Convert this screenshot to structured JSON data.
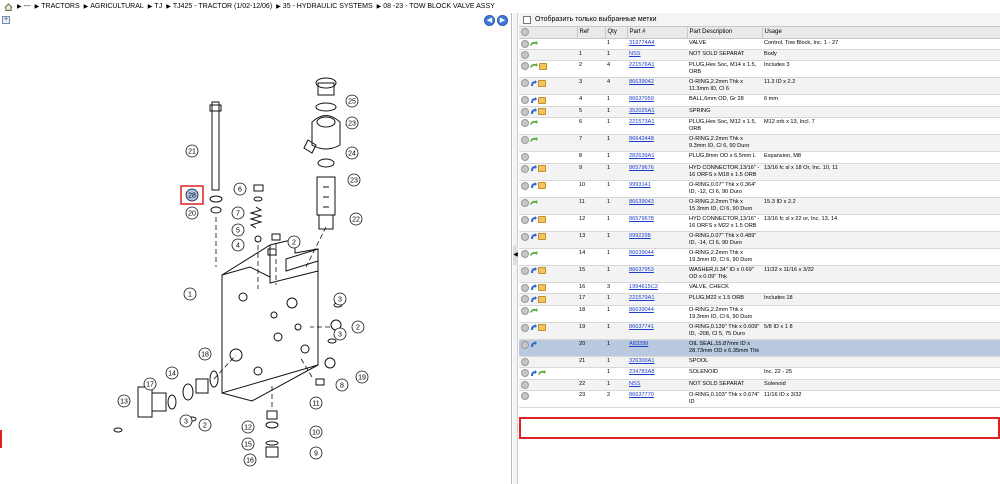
{
  "breadcrumb": {
    "items": [
      "---",
      "TRACTORS",
      "AGRICULTURAL",
      "TJ",
      "TJ425 - TRACTOR (1/02-12/06)",
      "35 - HYDRAULIC SYSTEMS",
      "08 -23 - TOW BLOCK VALVE ASSY"
    ]
  },
  "left_toolbar": {
    "plus": "+",
    "back": "◀",
    "forward": "▶"
  },
  "diagram": {
    "callouts": [
      "25",
      "23",
      "24",
      "21",
      "28",
      "20",
      "6",
      "7",
      "5",
      "4",
      "1",
      "2",
      "23",
      "22",
      "3",
      "2",
      "3",
      "19",
      "18",
      "14",
      "17",
      "13",
      "3",
      "2",
      "8",
      "11",
      "10",
      "9",
      "12",
      "15",
      "16"
    ],
    "highlight_label": "20"
  },
  "filter": {
    "label": "Отобразить только выбранные метки"
  },
  "table": {
    "headers": [
      "",
      "Ref",
      "Qty",
      "Part #",
      "Part Description",
      "Usage"
    ],
    "rows": [
      {
        "icons": [
          "info",
          "green"
        ],
        "ref": "",
        "qty": "1",
        "part": "319774A4",
        "desc": "VALVE",
        "usage": "Control, Tow Block, Inc. 1 - 27"
      },
      {
        "icons": [
          "info"
        ],
        "ref": "1",
        "qty": "1",
        "part": "NSS",
        "desc": "NOT SOLD SEPARAT",
        "usage": "Body"
      },
      {
        "icons": [
          "info",
          "green",
          "yellow"
        ],
        "ref": "2",
        "qty": "4",
        "part": "221576A1",
        "desc": "PLUG,Hex Soc, M14 x 1.5, ORB",
        "usage": "Includes 3"
      },
      {
        "icons": [
          "info",
          "blue",
          "yellow"
        ],
        "ref": "3",
        "qty": "4",
        "part": "86639042",
        "desc": "O-RING,2.2mm Thk x 11.3mm ID, Cl 6",
        "usage": "11.3 ID x 2.2"
      },
      {
        "icons": [
          "info",
          "blue",
          "yellow"
        ],
        "ref": "4",
        "qty": "1",
        "part": "86637959",
        "desc": "BALL,6mm OD, Gr 28",
        "usage": "6 mm"
      },
      {
        "icons": [
          "info",
          "blue",
          "yellow"
        ],
        "ref": "5",
        "qty": "1",
        "part": "352025A1",
        "desc": "SPRING",
        "usage": ""
      },
      {
        "icons": [
          "info",
          "green"
        ],
        "ref": "6",
        "qty": "1",
        "part": "221573A1",
        "desc": "PLUG,Hex Soc, M12 x 1.5, ORB",
        "usage": "M12 orb x 13, Incl. 7"
      },
      {
        "icons": [
          "info",
          "green"
        ],
        "ref": "7",
        "qty": "1",
        "part": "86642448",
        "desc": "O-RING,2.2mm Thk x 9.3mm ID, Cl 6, 90 Duro",
        "usage": ""
      },
      {
        "icons": [
          "info"
        ],
        "ref": "8",
        "qty": "1",
        "part": "282639A1",
        "desc": "PLUG,8mm OD x 6.5mm L",
        "usage": "Expansion, M8"
      },
      {
        "icons": [
          "info",
          "blue",
          "yellow"
        ],
        "ref": "9",
        "qty": "1",
        "part": "86579676",
        "desc": "HYD CONNECTOR,13/16\" - 16 ORFS x M18 x 1.5 ORB",
        "usage": "13/16 fc sl x 18 Or, Inc. 10, 11"
      },
      {
        "icons": [
          "info",
          "blue",
          "yellow"
        ],
        "ref": "10",
        "qty": "1",
        "part": "9993141",
        "desc": "O-RING,0.07\" Thk x 0.364\" ID, -12, Cl 6, 90 Duro",
        "usage": ""
      },
      {
        "icons": [
          "info",
          "green"
        ],
        "ref": "11",
        "qty": "1",
        "part": "86639043",
        "desc": "O-RING,2.2mm Thk x 15.3mm ID, Cl 6, 90 Duro",
        "usage": "15.3 ID x 2.2"
      },
      {
        "icons": [
          "info",
          "blue",
          "yellow"
        ],
        "ref": "12",
        "qty": "1",
        "part": "86579678",
        "desc": "HYD CONNECTOR,13/16\" - 16 ORFS x M22 x 1.5 ORB",
        "usage": "13/16 fc sl x 22 or, Inc. 13, 14"
      },
      {
        "icons": [
          "info",
          "blue",
          "yellow"
        ],
        "ref": "13",
        "qty": "1",
        "part": "9992298",
        "desc": "O-RING,0.07\" Thk x 0.489\" ID, -14, Cl 6, 90 Duro",
        "usage": ""
      },
      {
        "icons": [
          "info",
          "green"
        ],
        "ref": "14",
        "qty": "1",
        "part": "86639044",
        "desc": "O-RING,2.2mm Thk x 19.3mm ID, Cl 6, 90 Duro",
        "usage": ""
      },
      {
        "icons": [
          "info",
          "blue",
          "yellow"
        ],
        "ref": "15",
        "qty": "1",
        "part": "86637953",
        "desc": "WASHER,0.34\" ID x 0.69\" OD x 0.09\" Thk",
        "usage": "11/32 x 11/16 x 3/32"
      },
      {
        "icons": [
          "info",
          "blue",
          "yellow"
        ],
        "ref": "16",
        "qty": "3",
        "part": "1994615C2",
        "desc": "VALVE, CHECK",
        "usage": ""
      },
      {
        "icons": [
          "info",
          "blue",
          "yellow"
        ],
        "ref": "17",
        "qty": "1",
        "part": "221579A1",
        "desc": "PLUG,M22 x 1.5 ORB",
        "usage": "Includes 18"
      },
      {
        "icons": [
          "info",
          "green"
        ],
        "ref": "18",
        "qty": "1",
        "part": "86639044",
        "desc": "O-RING,2.2mm Thk x 19.3mm ID, Cl 6, 90 Duro",
        "usage": ""
      },
      {
        "icons": [
          "info",
          "blue",
          "yellow"
        ],
        "ref": "19",
        "qty": "1",
        "part": "86637741",
        "desc": "O-RING,0.139\" Thk x 0.609\" ID, -208, Cl 5, 75 Duro",
        "usage": "5/8 ID x 1 8"
      },
      {
        "icons": [
          "info",
          "blue"
        ],
        "ref": "20",
        "qty": "1",
        "part": "A83399",
        "desc": "OIL SEAL,15.87mm ID x 28.73mm OD x 6.35mm Thk",
        "usage": "",
        "selected": true
      },
      {
        "icons": [
          "info"
        ],
        "ref": "21",
        "qty": "1",
        "part": "326300A1",
        "desc": "SPOOL",
        "usage": ""
      },
      {
        "icons": [
          "info",
          "blue",
          "green"
        ],
        "ref": "",
        "qty": "1",
        "part": "234783A8",
        "desc": "SOLENOID",
        "usage": "Inc. 22 - 25"
      },
      {
        "icons": [
          "info"
        ],
        "ref": "22",
        "qty": "1",
        "part": "NSS",
        "desc": "NOT SOLD SEPARAT",
        "usage": "Solenoid"
      },
      {
        "icons": [
          "info"
        ],
        "ref": "23",
        "qty": "2",
        "part": "86637770",
        "desc": "O-RING,0.103\" Thk x 0.674\" ID",
        "usage": "11/16 ID x 3/32"
      }
    ]
  }
}
